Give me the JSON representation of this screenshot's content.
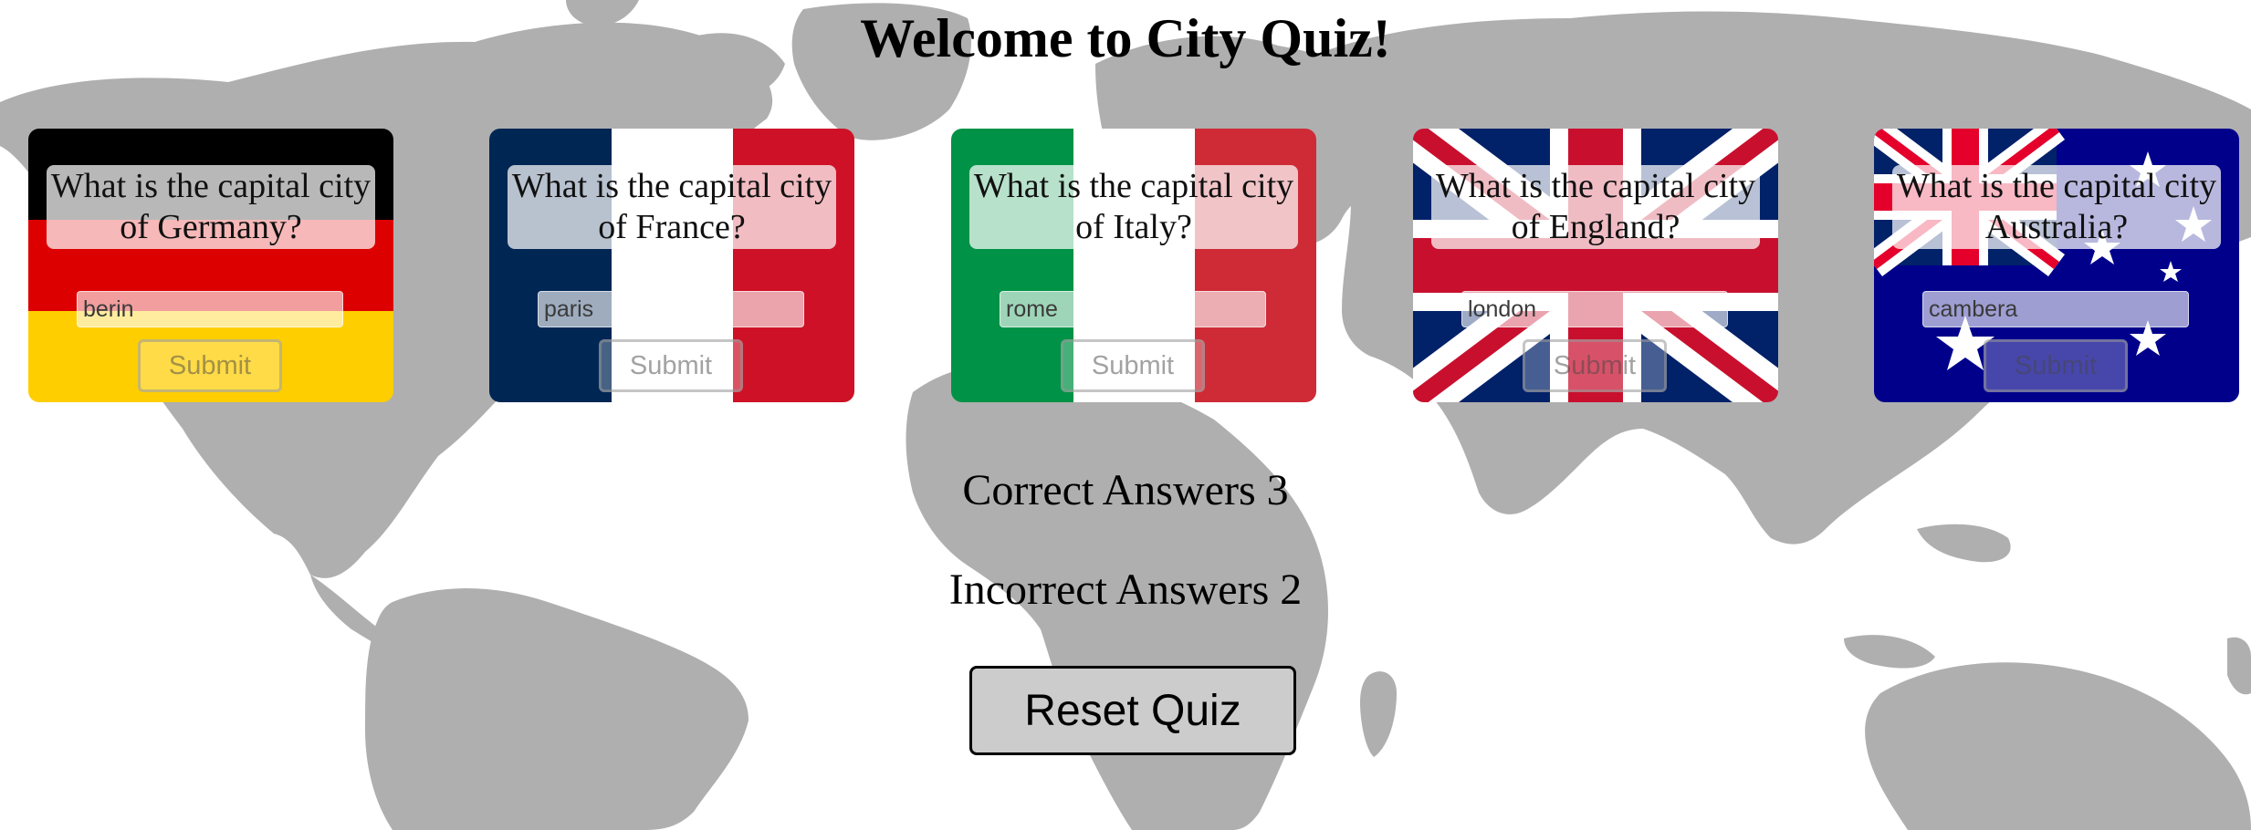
{
  "title": "Welcome to City Quiz!",
  "quiz": {
    "cards": [
      {
        "flag": "germany-flag",
        "question": "What is the capital city of Germany?",
        "answer_value": "berin",
        "submit_label": "Submit"
      },
      {
        "flag": "france-flag",
        "question": "What is the capital city of France?",
        "answer_value": "paris",
        "submit_label": "Submit"
      },
      {
        "flag": "italy-flag",
        "question": "What is the capital city of Italy?",
        "answer_value": "rome",
        "submit_label": "Submit"
      },
      {
        "flag": "united-kingdom-flag",
        "question": "What is the capital city of England?",
        "answer_value": "london",
        "submit_label": "Submit"
      },
      {
        "flag": "australia-flag",
        "question": "What is the capital city Australia?",
        "answer_value": "cambera",
        "submit_label": "Submit"
      }
    ]
  },
  "score": {
    "correct_text": "Correct Answers 3",
    "incorrect_text": "Incorrect Answers 2"
  },
  "reset_label": "Reset Quiz",
  "colors": {
    "map_land": "#afafaf",
    "reset_button_bg": "#cccccc",
    "germany": [
      "#000000",
      "#dd0000",
      "#ffce00"
    ],
    "france": [
      "#002654",
      "#ffffff",
      "#ce1126"
    ],
    "italy": [
      "#009246",
      "#ffffff",
      "#ce2b37"
    ],
    "union_jack": [
      "#012169",
      "#ffffff",
      "#c8102e"
    ],
    "australia": [
      "#00008b",
      "#ffffff",
      "#e4002b"
    ]
  }
}
